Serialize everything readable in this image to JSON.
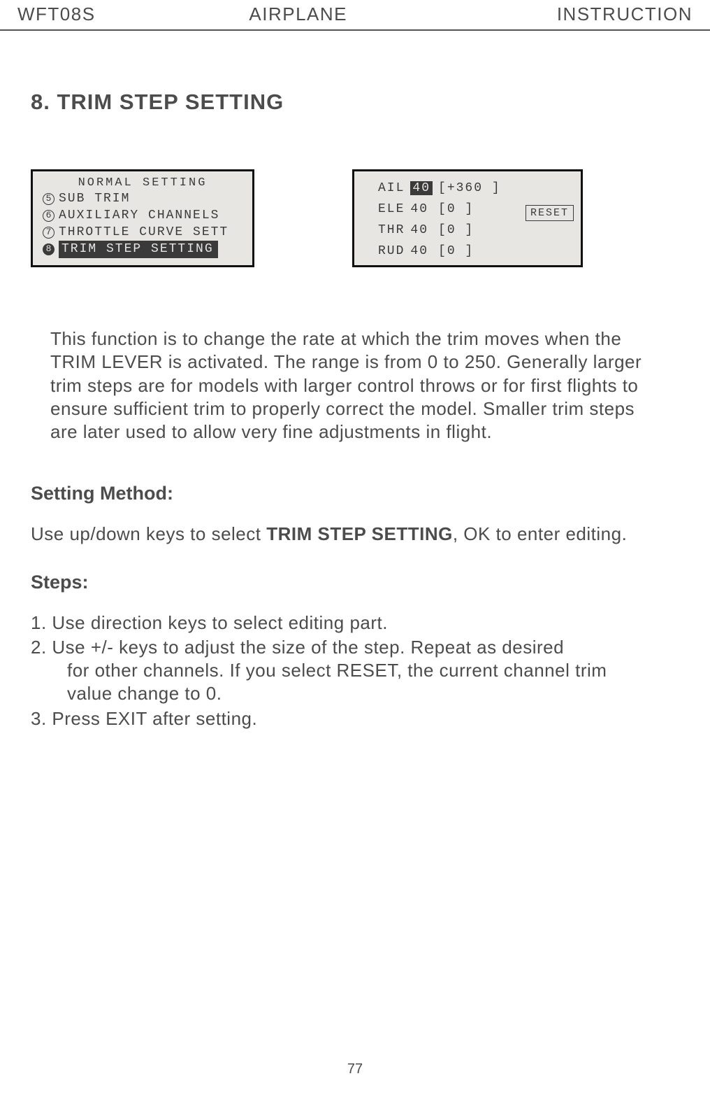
{
  "header": {
    "left": "WFT08S",
    "mid": "AIRPLANE",
    "right": "INSTRUCTION"
  },
  "title": "8. TRIM STEP SETTING",
  "screen1": {
    "header": "NORMAL SETTING",
    "items": [
      {
        "num": "5",
        "label": "SUB TRIM",
        "sel": false
      },
      {
        "num": "6",
        "label": "AUXILIARY CHANNELS",
        "sel": false
      },
      {
        "num": "7",
        "label": "THROTTLE CURVE SETT",
        "sel": false
      },
      {
        "num": "8",
        "label": "TRIM STEP SETTING",
        "sel": true
      }
    ]
  },
  "screen2": {
    "rows": [
      {
        "ch": "AIL",
        "step": "40",
        "suffix": "[+360 ]",
        "sel": true
      },
      {
        "ch": "ELE",
        "step": "40",
        "suffix": "[0    ]",
        "sel": false
      },
      {
        "ch": "THR",
        "step": "40",
        "suffix": "[0    ]",
        "sel": false
      },
      {
        "ch": "RUD",
        "step": "40",
        "suffix": "[0    ]",
        "sel": false
      }
    ],
    "reset": "RESET"
  },
  "description": "This function is to change the rate at which the trim moves when the TRIM LEVER is activated.  The range is from 0 to 250. Generally larger trim steps are for models with larger control throws or for first flights to ensure sufficient trim to properly correct the model. Smaller trim steps are later used to allow very fine adjustments in flight.",
  "setting_method_head": "Setting Method:",
  "setting_method_body_pre": "Use up/down keys to select ",
  "setting_method_body_bold": "TRIM STEP SETTING",
  "setting_method_body_post": ", OK to enter editing.",
  "steps_head": "Steps:",
  "steps": {
    "s1": "1. Use direction keys to select editing part.",
    "s2a": "2. Use +/- keys to adjust the size of the step. Repeat as desired",
    "s2b": "for other channels. If you select RESET, the current channel trim",
    "s2c": "value change to 0.",
    "s3": "3. Press EXIT after setting."
  },
  "pagenum": "77"
}
